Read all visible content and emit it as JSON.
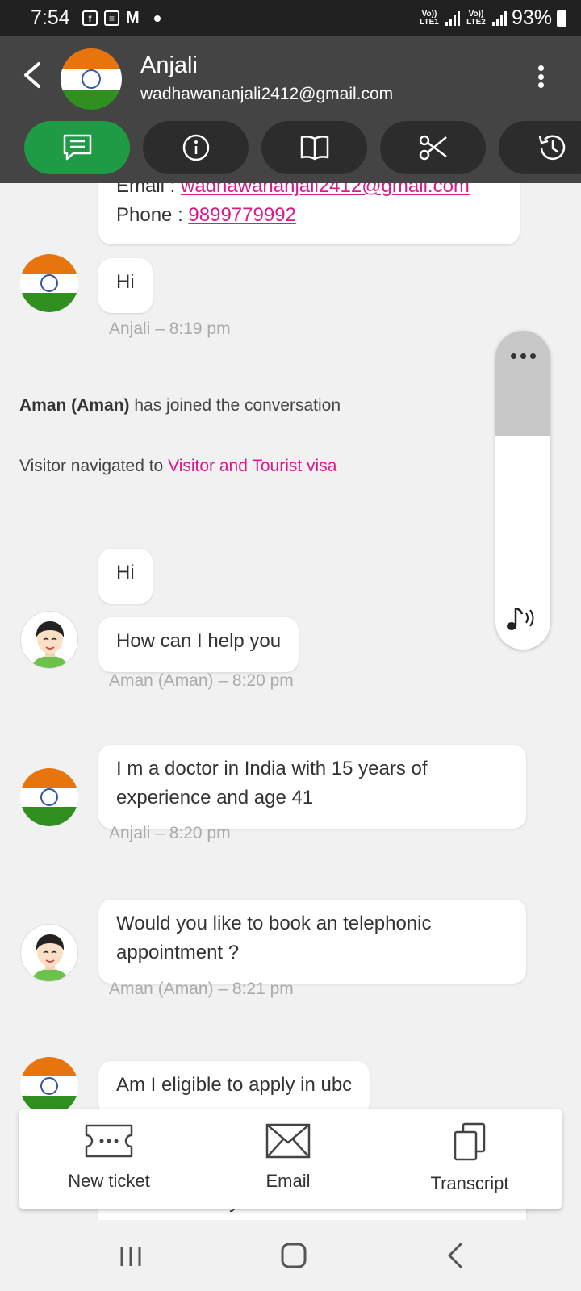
{
  "status_bar": {
    "time": "7:54",
    "battery": "93%",
    "network_1": "Vo)) LTE1",
    "network_2": "Vo)) LTE2"
  },
  "header": {
    "name": "Anjali",
    "email": "wadhawananjali2412@gmail.com",
    "tabs": [
      "chat-icon",
      "info-icon",
      "book-icon",
      "scissors-icon",
      "history-icon"
    ],
    "active_tab": "chat-icon"
  },
  "contact_card": {
    "email_label": "Email : ",
    "email_value": "wadhawananjali2412@gmail.com",
    "phone_label": "Phone : ",
    "phone_value": "9899779992"
  },
  "messages": [
    {
      "text": "Hi",
      "meta": "Anjali – 8:19 pm"
    },
    {
      "text": "Hi"
    },
    {
      "text": "How can I help you",
      "meta": "Aman (Aman) – 8:20 pm"
    },
    {
      "text": "I m a doctor in India with 15 years of experience and age 41",
      "meta": "Anjali – 8:20 pm"
    },
    {
      "text": "Would you like to book an telephonic appointment ?",
      "meta": "Aman (Aman) – 8:21 pm"
    },
    {
      "text": "Am I eligible to apply in ubc"
    },
    {
      "text": "Canada Study Visa"
    }
  ],
  "system": {
    "joined_name": "Aman (Aman)",
    "joined_text": " has joined the conversation",
    "nav_text": "Visitor navigated to ",
    "nav_link": "Visitor and Tourist visa"
  },
  "actions": {
    "new_ticket": "New ticket",
    "email": "Email",
    "transcript": "Transcript"
  },
  "colors": {
    "accent_green": "#1f9a45",
    "link_pink": "#d81b8a",
    "header_bg": "#444444"
  }
}
